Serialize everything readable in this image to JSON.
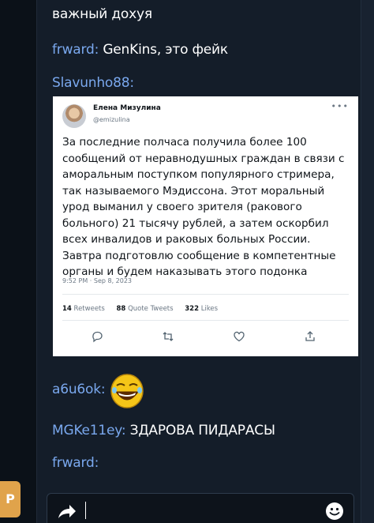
{
  "left_rail": {
    "tab_label": "Р"
  },
  "chat": {
    "messages": [
      {
        "nick": "",
        "text": "важный дохуя"
      },
      {
        "nick": "frward:",
        "text": " GenKins, это фейк"
      },
      {
        "nick": "Slavunho88:",
        "text": ""
      },
      {
        "nick": "a6u6ok:",
        "text": "",
        "emote": "laughing-emoji"
      },
      {
        "nick": "MGKe11ey:",
        "text": " ЗДАРОВА ПИДАРАСЫ"
      },
      {
        "nick": "frward:",
        "text": ""
      }
    ]
  },
  "tweet": {
    "author_name": "Елена Мизулина",
    "handle": "@emizulina",
    "body": "За последние полчаса получила более 100 сообщений от неравнодушных граждан в связи с аморальным поступком популярного стримера, так называемого Мэдиссона. Этот моральный урод выманил у своего зрителя (ракового больного) 21 тысячу рублей, а затем оскорбил всех инвалидов и раковых больных России. Завтра подготовлю сообщение в компетентные органы и будем наказывать этого подонка",
    "timestamp": "9:52 PM · Sep 8, 2023",
    "stats": {
      "retweets_count": "14",
      "retweets_label": "Retweets",
      "quotes_count": "88",
      "quotes_label": "Quote Tweets",
      "likes_count": "322",
      "likes_label": "Likes"
    }
  },
  "input": {
    "share_icon": "share-arrow-icon",
    "emoji_icon": "smiley-icon"
  },
  "colors": {
    "background": "#141d29",
    "nick": "#7aa8ee",
    "text": "#ffffff",
    "accent_tab": "#e0a34b"
  }
}
